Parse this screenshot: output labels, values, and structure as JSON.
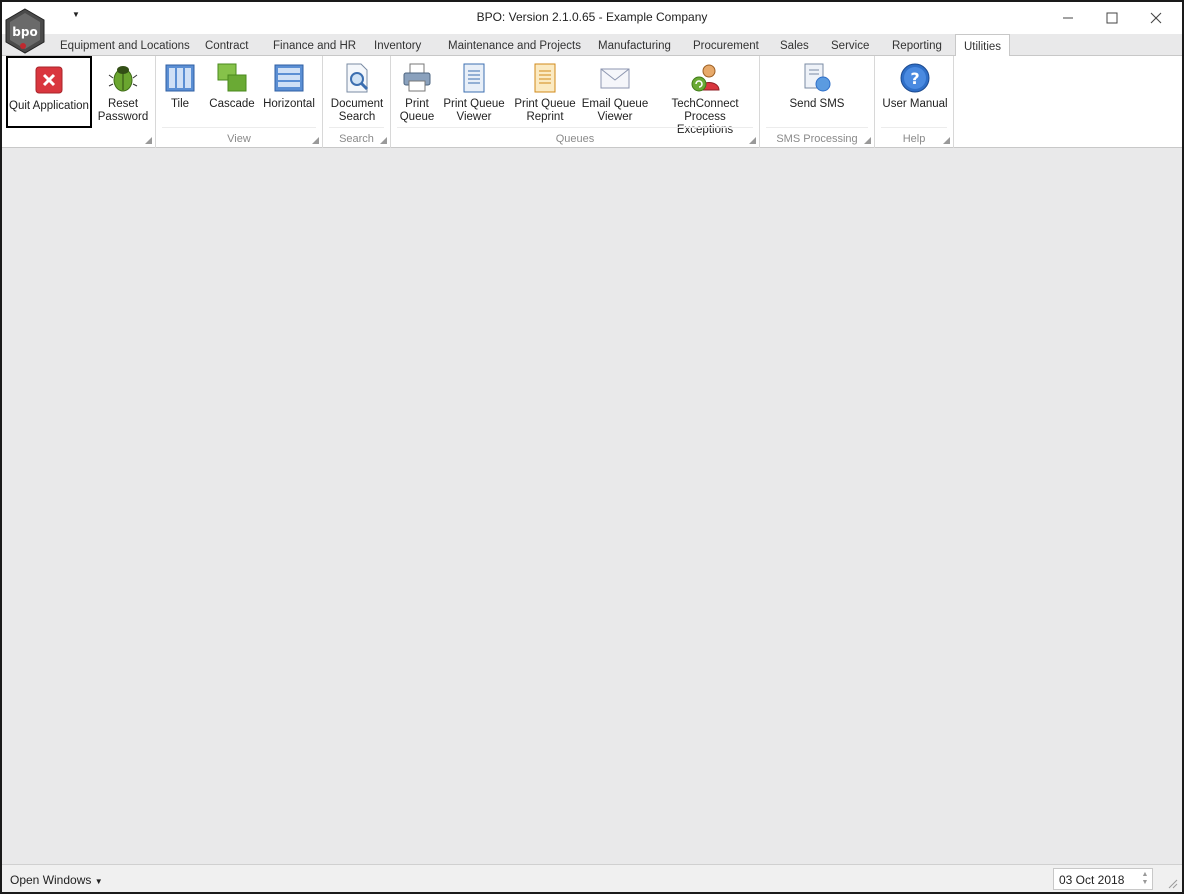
{
  "window": {
    "title": "BPO: Version 2.1.0.65 - Example Company",
    "logo_text": "bpo"
  },
  "tabs": [
    {
      "label": "Equipment and Locations"
    },
    {
      "label": "Contract"
    },
    {
      "label": "Finance and HR"
    },
    {
      "label": "Inventory"
    },
    {
      "label": "Maintenance and Projects"
    },
    {
      "label": "Manufacturing"
    },
    {
      "label": "Procurement"
    },
    {
      "label": "Sales"
    },
    {
      "label": "Service"
    },
    {
      "label": "Reporting"
    },
    {
      "label": "Utilities",
      "active": true
    }
  ],
  "ribbon": {
    "app": {
      "quit": {
        "line1": "Quit Application",
        "icon": "close-red-icon"
      },
      "reset": {
        "line1": "Reset",
        "line2": "Password",
        "icon": "bug-icon"
      }
    },
    "view": {
      "label": "View",
      "tile": {
        "line1": "Tile",
        "icon": "tile-icon"
      },
      "cascade": {
        "line1": "Cascade",
        "icon": "cascade-icon"
      },
      "horizontal": {
        "line1": "Horizontal",
        "icon": "horizontal-icon"
      }
    },
    "search": {
      "label": "Search",
      "document": {
        "line1": "Document",
        "line2": "Search",
        "icon": "document-search-icon"
      }
    },
    "queues": {
      "label": "Queues",
      "print_queue": {
        "line1": "Print",
        "line2": "Queue",
        "icon": "printer-icon"
      },
      "pq_viewer": {
        "line1": "Print Queue",
        "line2": "Viewer",
        "icon": "document-icon"
      },
      "pq_reprint": {
        "line1": "Print Queue",
        "line2": "Reprint",
        "icon": "document-yellow-icon"
      },
      "eq_viewer": {
        "line1": "Email Queue",
        "line2": "Viewer",
        "icon": "envelope-icon"
      },
      "techconnect": {
        "line1": "TechConnect",
        "line2": "Process Exceptions",
        "icon": "user-refresh-icon"
      }
    },
    "sms": {
      "label": "SMS Processing",
      "send": {
        "line1": "Send SMS",
        "icon": "sms-icon"
      }
    },
    "help": {
      "label": "Help",
      "manual": {
        "line1": "User Manual",
        "icon": "help-icon"
      }
    }
  },
  "statusbar": {
    "open_windows": "Open Windows",
    "date": "03 Oct 2018"
  },
  "colors": {
    "workspace": "#e9e9ea",
    "ribbon": "#ffffff",
    "accent_red": "#d9363e",
    "help_blue": "#2f6fc8"
  }
}
